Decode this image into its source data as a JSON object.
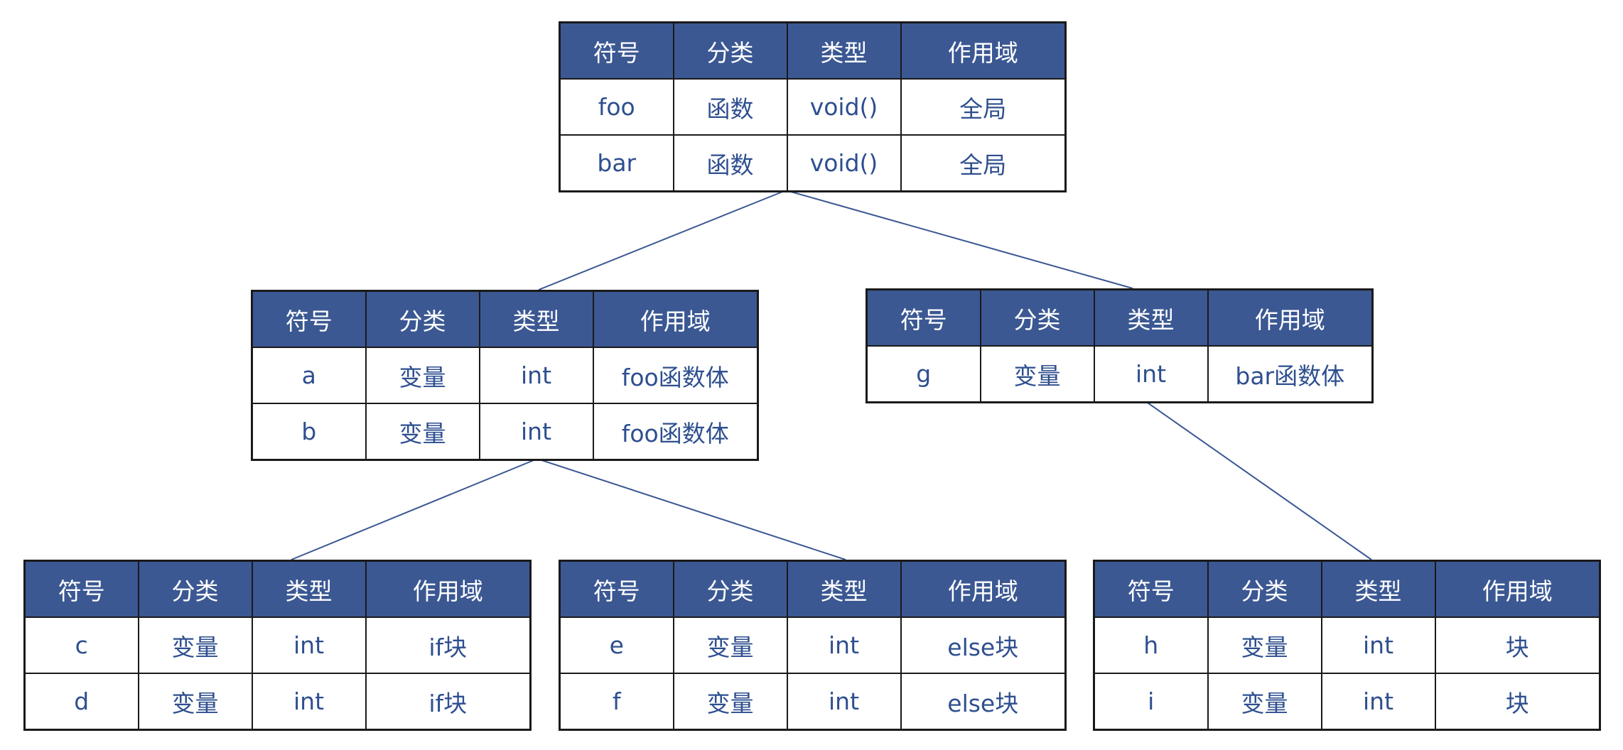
{
  "colors": {
    "header_bg": "#3b5893",
    "header_text": "#ffffff",
    "cell_text": "#2e4f8f",
    "border": "#1a1a1a",
    "connector": "#3b5893"
  },
  "tables": {
    "global": {
      "headers": [
        "符号",
        "分类",
        "类型",
        "作用域"
      ],
      "rows": [
        [
          "foo",
          "函数",
          "void()",
          "全局"
        ],
        [
          "bar",
          "函数",
          "void()",
          "全局"
        ]
      ]
    },
    "foo_body": {
      "headers": [
        "符号",
        "分类",
        "类型",
        "作用域"
      ],
      "rows": [
        [
          "a",
          "变量",
          "int",
          "foo函数体"
        ],
        [
          "b",
          "变量",
          "int",
          "foo函数体"
        ]
      ]
    },
    "bar_body": {
      "headers": [
        "符号",
        "分类",
        "类型",
        "作用域"
      ],
      "rows": [
        [
          "g",
          "变量",
          "int",
          "bar函数体"
        ]
      ]
    },
    "if_block": {
      "headers": [
        "符号",
        "分类",
        "类型",
        "作用域"
      ],
      "rows": [
        [
          "c",
          "变量",
          "int",
          "if块"
        ],
        [
          "d",
          "变量",
          "int",
          "if块"
        ]
      ]
    },
    "else_block": {
      "headers": [
        "符号",
        "分类",
        "类型",
        "作用域"
      ],
      "rows": [
        [
          "e",
          "变量",
          "int",
          "else块"
        ],
        [
          "f",
          "变量",
          "int",
          "else块"
        ]
      ]
    },
    "block": {
      "headers": [
        "符号",
        "分类",
        "类型",
        "作用域"
      ],
      "rows": [
        [
          "h",
          "变量",
          "int",
          "块"
        ],
        [
          "i",
          "变量",
          "int",
          "块"
        ]
      ]
    }
  },
  "edges": [
    [
      "global",
      "foo_body"
    ],
    [
      "global",
      "bar_body"
    ],
    [
      "foo_body",
      "if_block"
    ],
    [
      "foo_body",
      "else_block"
    ],
    [
      "bar_body",
      "block"
    ]
  ]
}
